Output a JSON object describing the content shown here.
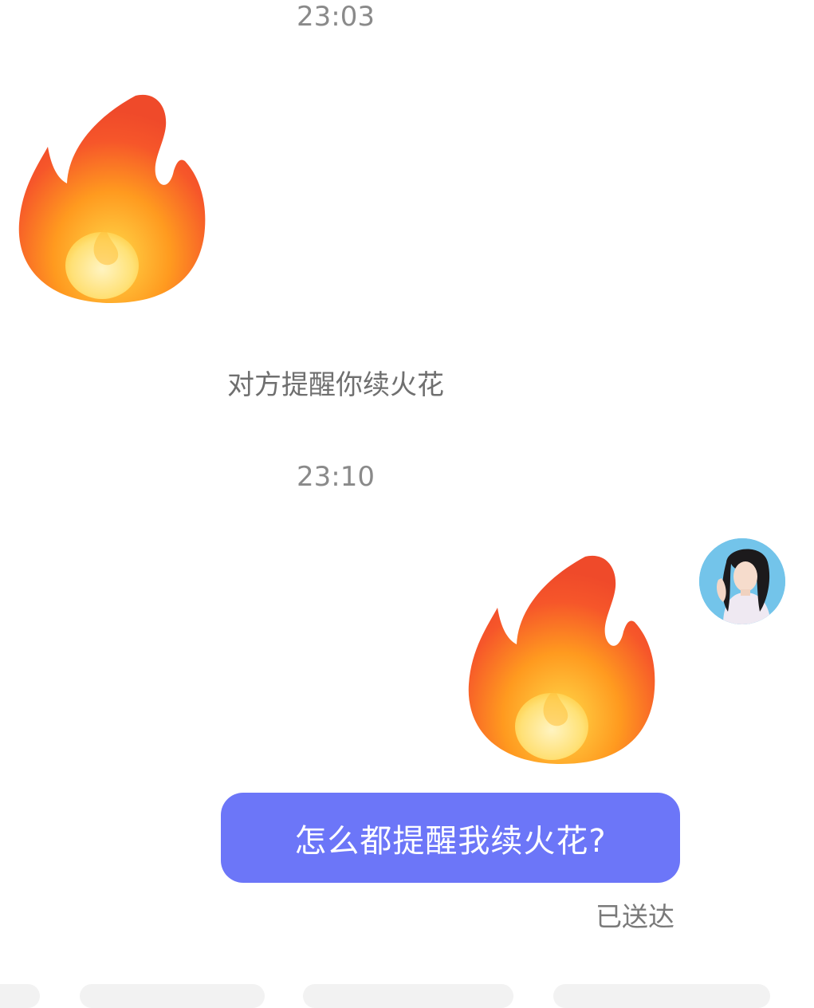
{
  "messages": {
    "time_1": "23:03",
    "system_notice": "对方提醒你续火花",
    "time_2": "23:10",
    "sent_text": "怎么都提醒我续火花?",
    "sent_status": "已送达"
  },
  "icons": {
    "received_sticker": "flame-icon",
    "sent_sticker": "flame-icon",
    "avatar": "user-avatar"
  },
  "colors": {
    "bubble": "#6c76f8",
    "timestamp": "#8a8a8a",
    "flame_outer": "#f2572a",
    "flame_inner": "#ffe88a"
  }
}
